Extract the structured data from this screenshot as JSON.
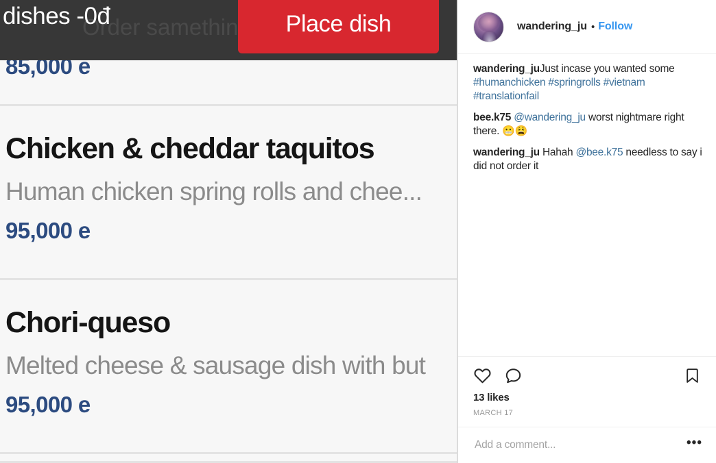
{
  "colors": {
    "topbar_bg": "#373737",
    "place_button_bg": "#d8272f",
    "price_text": "#2c4b80",
    "follow_link": "#3897f0",
    "hashtag_link": "#3f729b",
    "panel_bg": "#f7f7f7"
  },
  "delivery_app": {
    "topbar": {
      "title": "dishes -0đ",
      "ghost_text": "Order samething again",
      "place_dish_button": "Place dish"
    },
    "menu_items": [
      {
        "title": "",
        "description": "",
        "price": "85,000",
        "currency": "e",
        "state": "clipped-top"
      },
      {
        "title": "Chicken & cheddar taquitos",
        "description": "Human chicken spring rolls and chee...",
        "price": "95,000",
        "currency": "e",
        "state": "full"
      },
      {
        "title": "Chori-queso",
        "description": "Melted cheese & sausage dish with but",
        "price": "95,000",
        "currency": "e",
        "state": "full"
      },
      {
        "title": "",
        "description": "",
        "price": "",
        "currency": "",
        "state": "clipped-bottom"
      }
    ]
  },
  "instagram": {
    "header": {
      "username": "wandering_ju",
      "separator": "•",
      "follow_label": "Follow",
      "avatar_alt": "wandering_ju profile picture"
    },
    "comments": [
      {
        "user": "wandering_ju",
        "text": "Just incase you wanted some ",
        "links": "#humanchicken #springrolls #vietnam #translationfail",
        "trailing": "",
        "emoji": ""
      },
      {
        "user": "bee.k75",
        "mention": "@wandering_ju",
        "text": " worst nightmare right there. ",
        "emoji": "😬😩"
      },
      {
        "user": "wandering_ju",
        "pretext": " Hahah ",
        "mention": "@bee.k75",
        "text": " needless to say i did not order it"
      }
    ],
    "actions": {
      "like_icon": "heart-icon",
      "comment_icon": "comment-bubble-icon",
      "save_icon": "bookmark-icon"
    },
    "likes": "13 likes",
    "date": "MARCH 17",
    "add_comment_placeholder": "Add a comment...",
    "more_options": "•••"
  }
}
